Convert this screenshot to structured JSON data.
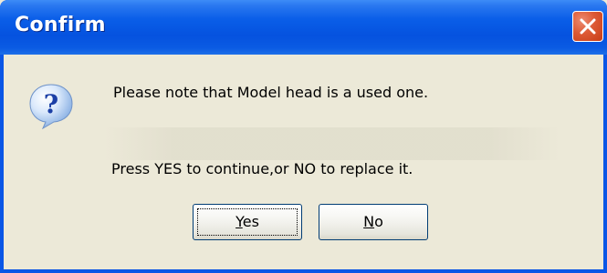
{
  "window": {
    "title": "Confirm"
  },
  "icons": {
    "message_icon": "question-icon",
    "close_icon": "close-icon"
  },
  "message": {
    "line1": "Please note that Model head is a used one.",
    "line2": "Press YES to continue,or NO to replace it."
  },
  "buttons": {
    "yes": {
      "mnemonic": "Y",
      "rest": "es"
    },
    "no": {
      "mnemonic": "N",
      "rest": "o"
    }
  },
  "colors": {
    "titlebar": "#0a5ee8",
    "dialog_bg": "#ece9d8",
    "close_button": "#dd5a35"
  }
}
